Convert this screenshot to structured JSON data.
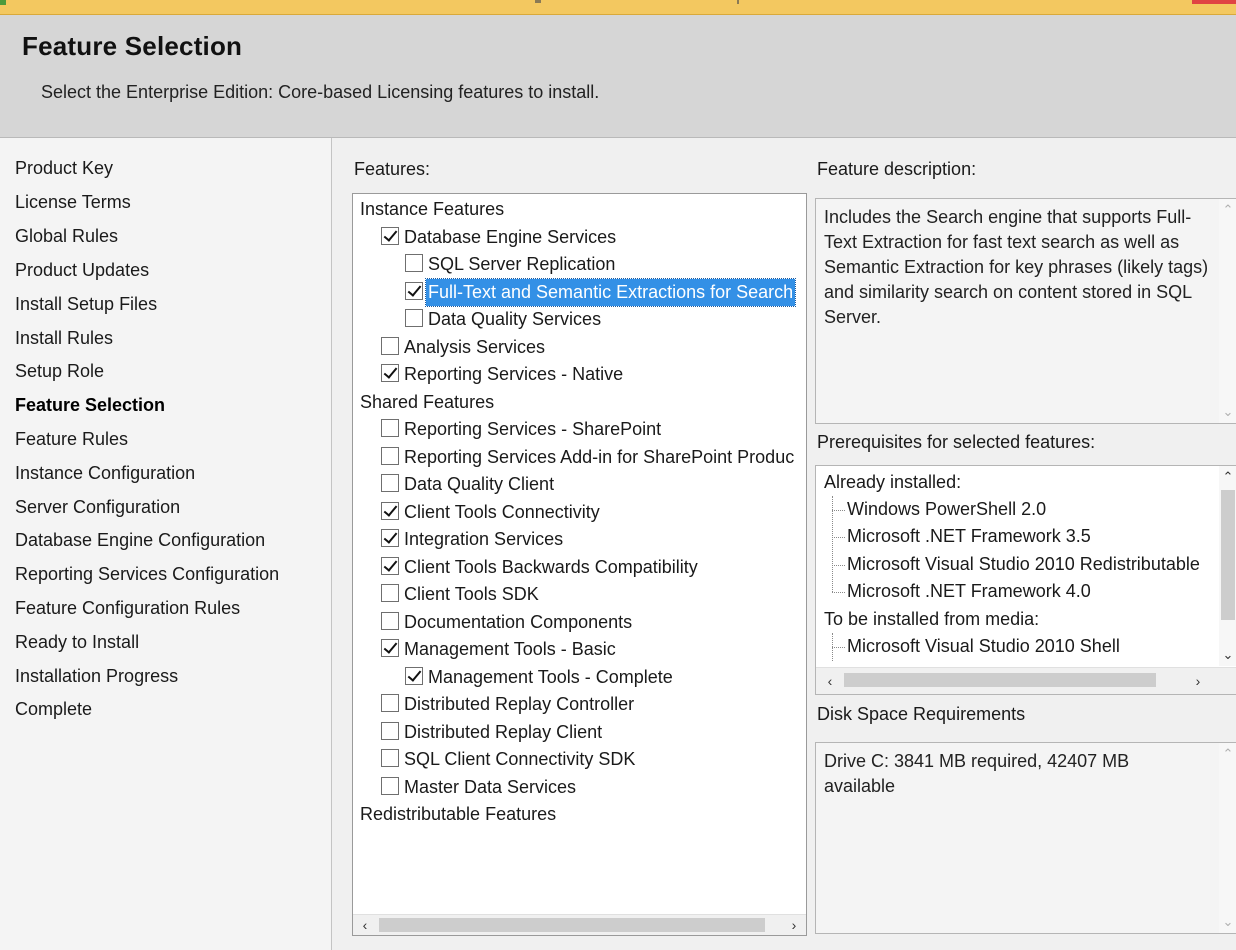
{
  "header": {
    "title": "Feature Selection",
    "subtitle": "Select the Enterprise Edition: Core-based Licensing features to install."
  },
  "sidebar": {
    "items": [
      {
        "label": "Product Key",
        "active": false
      },
      {
        "label": "License Terms",
        "active": false
      },
      {
        "label": "Global Rules",
        "active": false
      },
      {
        "label": "Product Updates",
        "active": false
      },
      {
        "label": "Install Setup Files",
        "active": false
      },
      {
        "label": "Install Rules",
        "active": false
      },
      {
        "label": "Setup Role",
        "active": false
      },
      {
        "label": "Feature Selection",
        "active": true
      },
      {
        "label": "Feature Rules",
        "active": false
      },
      {
        "label": "Instance Configuration",
        "active": false
      },
      {
        "label": "Server Configuration",
        "active": false
      },
      {
        "label": "Database Engine Configuration",
        "active": false
      },
      {
        "label": "Reporting Services Configuration",
        "active": false
      },
      {
        "label": "Feature Configuration Rules",
        "active": false
      },
      {
        "label": "Ready to Install",
        "active": false
      },
      {
        "label": "Installation Progress",
        "active": false
      },
      {
        "label": "Complete",
        "active": false
      }
    ]
  },
  "features": {
    "label": "Features:",
    "groups": {
      "instance": "Instance Features",
      "shared": "Shared Features",
      "redist": "Redistributable Features"
    },
    "items": [
      {
        "label": "Database Engine Services",
        "checked": true,
        "selected": false
      },
      {
        "label": "SQL Server Replication",
        "checked": false,
        "selected": false
      },
      {
        "label": "Full-Text and Semantic Extractions for Search",
        "checked": true,
        "selected": true
      },
      {
        "label": "Data Quality Services",
        "checked": false,
        "selected": false
      },
      {
        "label": "Analysis Services",
        "checked": false,
        "selected": false
      },
      {
        "label": "Reporting Services - Native",
        "checked": true,
        "selected": false
      },
      {
        "label": "Reporting Services - SharePoint",
        "checked": false,
        "selected": false
      },
      {
        "label": "Reporting Services Add-in for SharePoint Produc",
        "checked": false,
        "selected": false
      },
      {
        "label": "Data Quality Client",
        "checked": false,
        "selected": false
      },
      {
        "label": "Client Tools Connectivity",
        "checked": true,
        "selected": false
      },
      {
        "label": "Integration Services",
        "checked": true,
        "selected": false
      },
      {
        "label": "Client Tools Backwards Compatibility",
        "checked": true,
        "selected": false
      },
      {
        "label": "Client Tools SDK",
        "checked": false,
        "selected": false
      },
      {
        "label": "Documentation Components",
        "checked": false,
        "selected": false
      },
      {
        "label": "Management Tools - Basic",
        "checked": true,
        "selected": false
      },
      {
        "label": "Management Tools - Complete",
        "checked": true,
        "selected": false
      },
      {
        "label": "Distributed Replay Controller",
        "checked": false,
        "selected": false
      },
      {
        "label": "Distributed Replay Client",
        "checked": false,
        "selected": false
      },
      {
        "label": "SQL Client Connectivity SDK",
        "checked": false,
        "selected": false
      },
      {
        "label": "Master Data Services",
        "checked": false,
        "selected": false
      }
    ]
  },
  "description": {
    "label": "Feature description:",
    "text": "Includes the Search engine that supports Full-Text Extraction for fast text search as well as Semantic Extraction for key phrases (likely tags) and similarity search on content stored in SQL Server."
  },
  "prerequisites": {
    "label": "Prerequisites for selected features:",
    "installed_label": "Already installed:",
    "installed": [
      "Windows PowerShell 2.0",
      "Microsoft .NET Framework 3.5",
      "Microsoft Visual Studio 2010 Redistributable",
      "Microsoft .NET Framework 4.0"
    ],
    "media_label": "To be installed from media:",
    "media": [
      "Microsoft Visual Studio 2010 Shell"
    ]
  },
  "disk": {
    "label": "Disk Space Requirements",
    "text": "Drive C: 3841 MB required, 42407 MB available"
  },
  "icons": {
    "scroll_left": "‹",
    "scroll_right": "›",
    "scroll_up": "⌃",
    "scroll_down": "⌄"
  }
}
